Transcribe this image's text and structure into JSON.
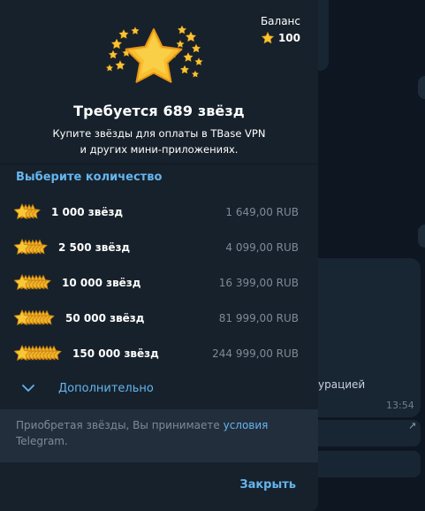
{
  "background": {
    "message_fragment": "урацией",
    "message_time": "13:54"
  },
  "modal": {
    "balance": {
      "label": "Баланс",
      "value": "100"
    },
    "title": "Требуется 689 звёзд",
    "subtitle_line1": "Купите звёзды для оплаты в TBase VPN",
    "subtitle_line2": "и других мини-приложениях.",
    "section_title": "Выберите количество",
    "options": [
      {
        "label": "1 000 звёзд",
        "price": "1 649,00 RUB",
        "stack": 4
      },
      {
        "label": "2 500 звёзд",
        "price": "4 099,00 RUB",
        "stack": 6
      },
      {
        "label": "10 000 звёзд",
        "price": "16 399,00 RUB",
        "stack": 7
      },
      {
        "label": "50 000 звёзд",
        "price": "81 999,00 RUB",
        "stack": 8
      },
      {
        "label": "150 000 звёзд",
        "price": "244 999,00 RUB",
        "stack": 10
      }
    ],
    "more_label": "Дополнительно",
    "footer_text_before": "Приобретая звёзды, Вы принимаете",
    "footer_link": "условия",
    "footer_text_after": "Telegram.",
    "close_label": "Закрыть"
  },
  "colors": {
    "accent": "#64b5ef",
    "star": "#f7c433",
    "modal_bg": "#17212b",
    "footer_bg": "#232e3c",
    "muted": "#7c8b99"
  }
}
